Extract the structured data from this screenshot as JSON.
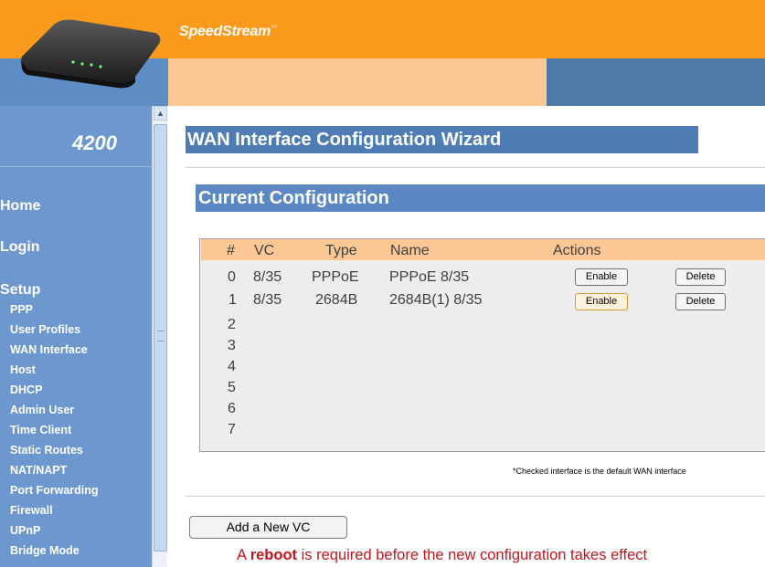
{
  "header": {
    "brand": "SpeedStream",
    "trademark": "™"
  },
  "sidebar": {
    "model": "4200",
    "main_items": [
      {
        "label": "Home"
      },
      {
        "label": "Login"
      },
      {
        "label": "Setup"
      }
    ],
    "setup_items": [
      {
        "label": "PPP"
      },
      {
        "label": "User Profiles"
      },
      {
        "label": "WAN Interface"
      },
      {
        "label": "Host"
      },
      {
        "label": "DHCP"
      },
      {
        "label": "Admin User"
      },
      {
        "label": "Time Client"
      },
      {
        "label": "Static Routes"
      },
      {
        "label": "NAT/NAPT"
      },
      {
        "label": "Port Forwarding"
      },
      {
        "label": "Firewall"
      },
      {
        "label": "UPnP"
      },
      {
        "label": "Bridge Mode"
      }
    ]
  },
  "main": {
    "wizard_title": "WAN Interface Configuration Wizard",
    "section_title": "Current Configuration",
    "table": {
      "headers": {
        "num": "#",
        "vc": "VC",
        "type": "Type",
        "name": "Name",
        "actions": "Actions"
      },
      "rows": [
        {
          "num": "0",
          "vc": "8/35",
          "type": "PPPoE",
          "name": "PPPoE 8/35",
          "enable": "Enable",
          "delete": "Delete"
        },
        {
          "num": "1",
          "vc": "8/35",
          "type": "2684B",
          "name": "2684B(1) 8/35",
          "enable": "Enable",
          "delete": "Delete"
        },
        {
          "num": "2"
        },
        {
          "num": "3"
        },
        {
          "num": "4"
        },
        {
          "num": "5"
        },
        {
          "num": "6"
        },
        {
          "num": "7"
        }
      ]
    },
    "note": "*Checked interface is the default WAN interface",
    "add_button": "Add a New VC",
    "reboot_prefix": "A ",
    "reboot_word": "reboot",
    "reboot_suffix": " is required before the new configuration takes effect"
  },
  "colors": {
    "header_orange": "#f99a1c",
    "header_peach": "#fbc794",
    "sidebar_blue": "#6d98cf",
    "title_blue": "#4e7db6",
    "reboot_red": "#c0161d"
  }
}
